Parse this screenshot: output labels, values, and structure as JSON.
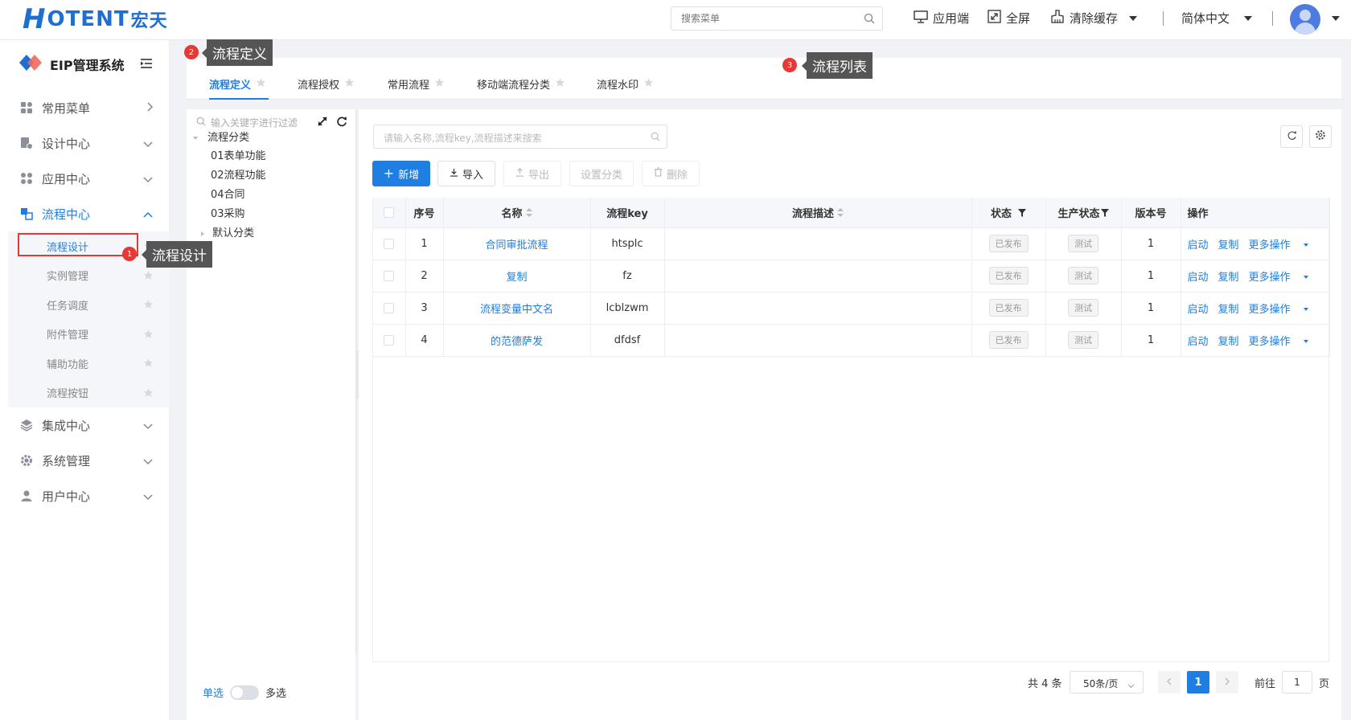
{
  "header": {
    "logo_h": "H",
    "logo_text": "OTENT",
    "logo_cn": "宏天",
    "search_placeholder": "搜索菜单",
    "app_label": "应用端",
    "fullscreen_label": "全屏",
    "clear_cache_label": "清除缓存",
    "language_label": "简体中文",
    "sep": "|"
  },
  "sidebar": {
    "system_title": "EIP管理系统",
    "items": [
      {
        "label": "常用菜单",
        "icon": "grid-icon"
      },
      {
        "label": "设计中心",
        "icon": "design-icon"
      },
      {
        "label": "应用中心",
        "icon": "apps-icon"
      },
      {
        "label": "流程中心",
        "icon": "flow-icon"
      }
    ],
    "sub_items": [
      {
        "label": "流程设计"
      },
      {
        "label": "实例管理"
      },
      {
        "label": "任务调度"
      },
      {
        "label": "附件管理"
      },
      {
        "label": "辅助功能"
      },
      {
        "label": "流程按钮"
      }
    ],
    "items_after": [
      {
        "label": "集成中心",
        "icon": "layers-icon"
      },
      {
        "label": "系统管理",
        "icon": "gear-icon"
      },
      {
        "label": "用户中心",
        "icon": "user-icon"
      }
    ]
  },
  "annotations": {
    "one": {
      "num": "1",
      "text": "流程设计"
    },
    "two": {
      "num": "2",
      "text": "流程定义"
    },
    "three": {
      "num": "3",
      "text": "流程列表"
    }
  },
  "tabs": [
    {
      "label": "流程定义",
      "active": true
    },
    {
      "label": "流程授权"
    },
    {
      "label": "常用流程"
    },
    {
      "label": "移动端流程分类"
    },
    {
      "label": "流程水印"
    }
  ],
  "tree": {
    "filter_placeholder": "输入关键字进行过滤",
    "root": "流程分类",
    "children": [
      "01表单功能",
      "02流程功能",
      "04合同",
      "03采购",
      "默认分类"
    ],
    "mode_single": "单选",
    "mode_multi": "多选"
  },
  "list": {
    "search_placeholder": "请输入名称,流程key,流程描述来搜索",
    "buttons": {
      "add": "新增",
      "import": "导入",
      "export": "导出",
      "set_category": "设置分类",
      "delete": "删除"
    },
    "columns": {
      "index": "序号",
      "name": "名称",
      "key": "流程key",
      "desc": "流程描述",
      "status": "状态",
      "prod_status": "生产状态",
      "version": "版本号",
      "ops": "操作"
    },
    "rows": [
      {
        "index": "1",
        "name": "合同审批流程",
        "key": "htsplc",
        "desc": "",
        "status": "已发布",
        "prod_status": "测试",
        "version": "1"
      },
      {
        "index": "2",
        "name": "复制",
        "key": "fz",
        "desc": "",
        "status": "已发布",
        "prod_status": "测试",
        "version": "1"
      },
      {
        "index": "3",
        "name": "流程变量中文名",
        "key": "lcblzwm",
        "desc": "",
        "status": "已发布",
        "prod_status": "测试",
        "version": "1"
      },
      {
        "index": "4",
        "name": "的范德萨发",
        "key": "dfdsf",
        "desc": "",
        "status": "已发布",
        "prod_status": "测试",
        "version": "1"
      }
    ],
    "ops": {
      "start": "启动",
      "copy": "复制",
      "more": "更多操作"
    }
  },
  "pagination": {
    "total": "共 4 条",
    "page_size": "50条/页",
    "current_page": "1",
    "goto_label": "前往",
    "goto_value": "1",
    "page_unit": "页"
  },
  "colors": {
    "accent": "#1f7ee1",
    "annotation_red": "#e53935",
    "tooltip_bg": "#555555"
  }
}
